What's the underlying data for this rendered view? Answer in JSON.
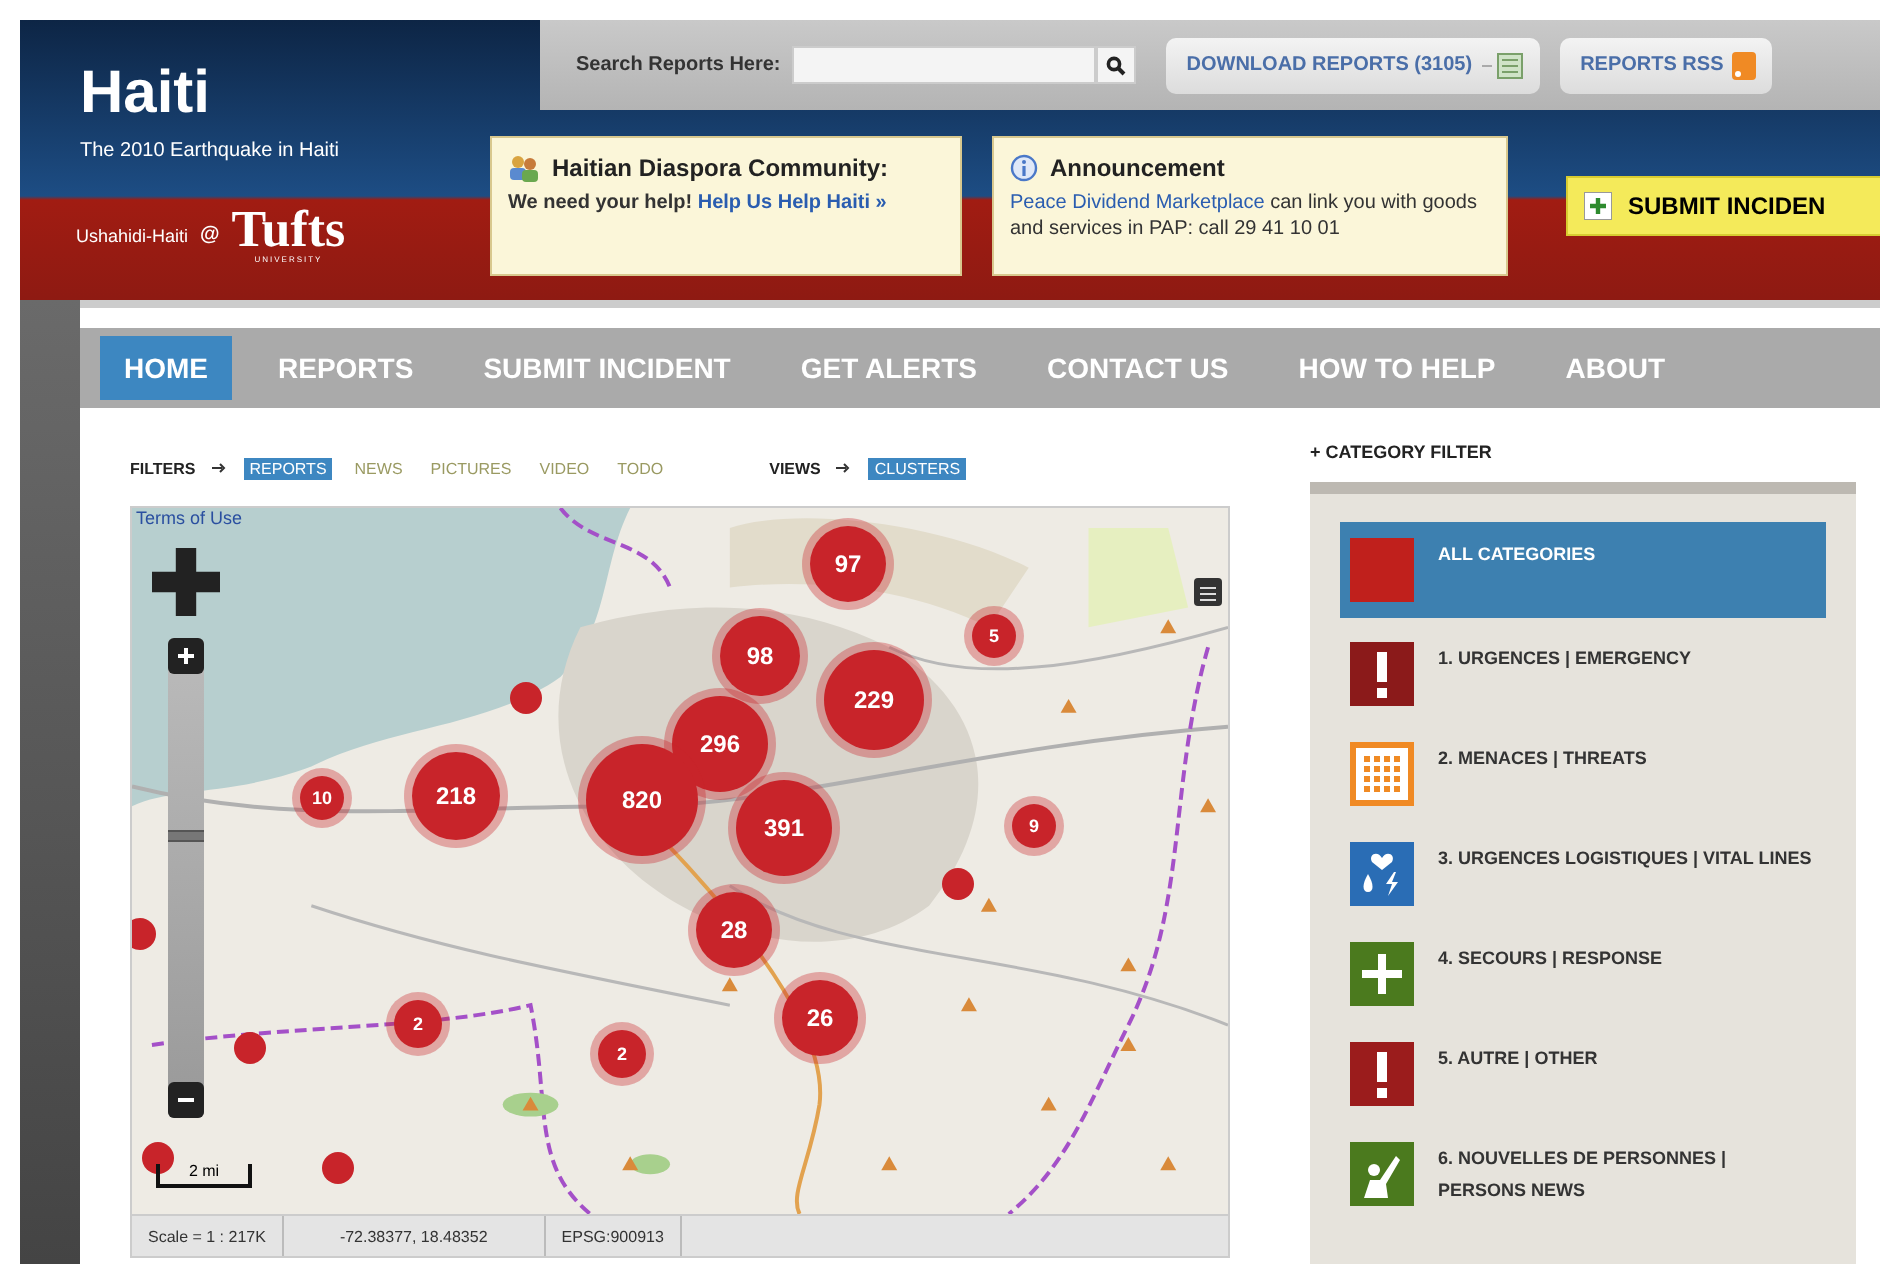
{
  "site": {
    "title": "Haiti",
    "subtitle": "The 2010 Earthquake in Haiti",
    "credit": "Ushahidi-Haiti",
    "at": "@",
    "logo": "Tufts",
    "logo_sub": "UNIVERSITY"
  },
  "search": {
    "label": "Search Reports Here:"
  },
  "top_buttons": [
    {
      "label": "DOWNLOAD REPORTS (3105)",
      "kind": "download"
    },
    {
      "label": "REPORTS RSS",
      "kind": "rss"
    }
  ],
  "notices": [
    {
      "kind": "community",
      "title": "Haitian Diaspora Community:",
      "segments": [
        {
          "kind": "plain",
          "text": "We need your help!"
        },
        {
          "kind": "link",
          "text": "Help Us Help Haiti »"
        }
      ]
    },
    {
      "kind": "info",
      "title": "Announcement",
      "segments": [
        {
          "kind": "link",
          "text": "Peace Dividend Marketplace"
        },
        {
          "kind": "plain",
          "text": "can link you with goods and services in PAP: call 29 41 10 01"
        }
      ]
    }
  ],
  "submit_button": "SUBMIT INCIDEN",
  "nav": [
    {
      "label": "HOME",
      "selected": true
    },
    {
      "label": "REPORTS",
      "selected": false
    },
    {
      "label": "SUBMIT INCIDENT",
      "selected": false
    },
    {
      "label": "GET ALERTS",
      "selected": false
    },
    {
      "label": "CONTACT US",
      "selected": false
    },
    {
      "label": "HOW TO HELP",
      "selected": false
    },
    {
      "label": "ABOUT",
      "selected": false
    }
  ],
  "filters": {
    "label": "FILTERS",
    "items": [
      {
        "label": "REPORTS",
        "selected": true
      },
      {
        "label": "NEWS",
        "selected": false
      },
      {
        "label": "PICTURES",
        "selected": false
      },
      {
        "label": "VIDEO",
        "selected": false
      },
      {
        "label": "TODO",
        "selected": false
      }
    ]
  },
  "views": {
    "label": "VIEWS",
    "items": [
      {
        "label": "CLUSTERS",
        "selected": true
      }
    ]
  },
  "map": {
    "terms_link": "Terms of Use",
    "scale_bar": "2 mi",
    "zoom": {
      "level": 0.6
    },
    "clusters": [
      {
        "label": "97"
      },
      {
        "label": "5"
      },
      {
        "label": "98"
      },
      {
        "label": "229"
      },
      {
        "label": "296"
      },
      {
        "label": "218"
      },
      {
        "label": "820"
      },
      {
        "label": "391"
      },
      {
        "label": "10"
      },
      {
        "label": "9"
      },
      {
        "label": "28"
      },
      {
        "label": "26"
      },
      {
        "label": "2"
      },
      {
        "label": "2"
      }
    ],
    "status": [
      "Scale = 1 : 217K",
      "-72.38377, 18.48352",
      "EPSG:900913"
    ]
  },
  "category_filter": {
    "heading": "+ CATEGORY FILTER",
    "items": [
      {
        "label": "ALL CATEGORIES",
        "kind": "all",
        "color": "#c0201c",
        "selected": true
      },
      {
        "label": "1. URGENCES | EMERGENCY",
        "kind": "alert",
        "color": "#8b1a1a",
        "selected": false
      },
      {
        "label": "2. MENACES | THREATS",
        "kind": "grid",
        "color": "#f08a24",
        "selected": false
      },
      {
        "label": "3. URGENCES LOGISTIQUES | VITAL LINES",
        "kind": "water",
        "color": "#2a6db5",
        "selected": false
      },
      {
        "label": "4. SECOURS | RESPONSE",
        "kind": "plus",
        "color": "#4b7a1e",
        "selected": false
      },
      {
        "label": "5. AUTRE | OTHER",
        "kind": "alert",
        "color": "#9b1c1c",
        "selected": false
      },
      {
        "label": "6. NOUVELLES DE PERSONNES | PERSONS NEWS",
        "kind": "person",
        "color": "#4b7a1e",
        "selected": false
      }
    ]
  }
}
